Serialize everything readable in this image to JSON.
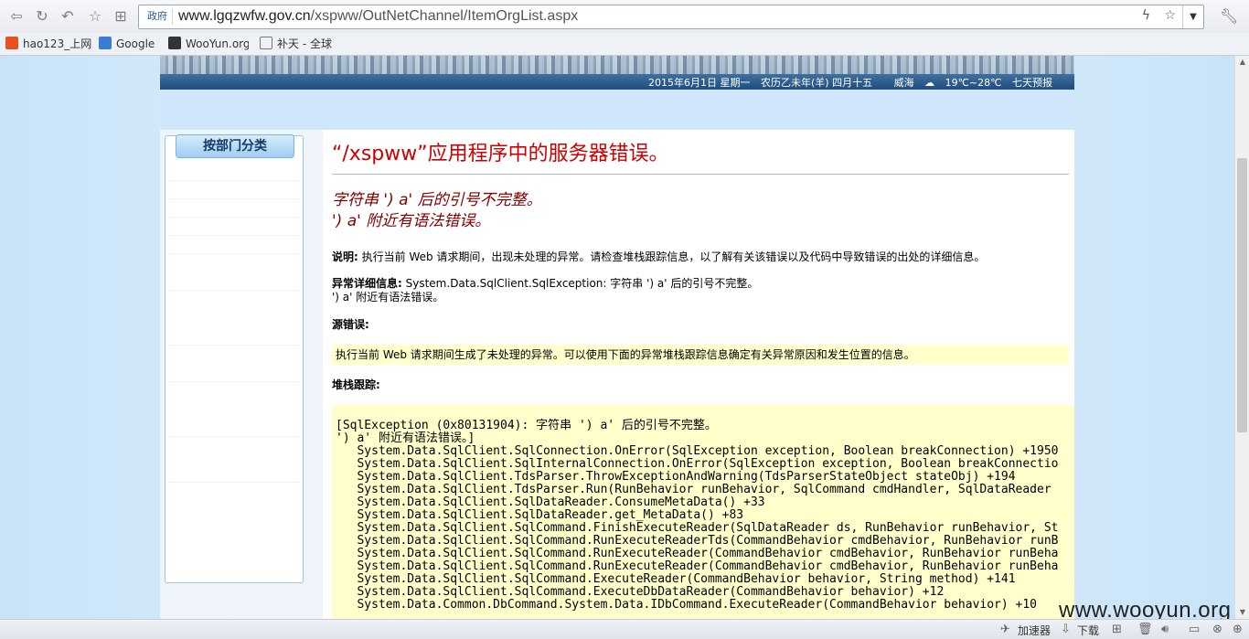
{
  "browser": {
    "address_badge": "政府",
    "url_host": "www.lgqzwfw.gov.cn",
    "url_path": "/xspww/OutNetChannel/ItemOrgList.aspx",
    "bookmarks": [
      "hao123_上网",
      "Google",
      "WooYun.org",
      "补天 - 全球"
    ]
  },
  "banner": {
    "date": "2015年6月1日 星期一",
    "lunar": "农历乙未年(羊) 四月十五",
    "city": "威海",
    "temp": "19℃~28℃",
    "forecast": "七天预报"
  },
  "sidebar": {
    "heading": "按部门分类"
  },
  "error": {
    "title": "“/xspww”应用程序中的服务器错误。",
    "message_line1": "字符串 ') a' 后的引号不完整。",
    "message_line2": "') a' 附近有语法错误。",
    "desc_label": "说明:",
    "desc_text": " 执行当前 Web 请求期间，出现未处理的异常。请检查堆栈跟踪信息，以了解有关该错误以及代码中导致错误的出处的详细信息。",
    "exc_label": "异常详细信息:",
    "exc_text": " System.Data.SqlClient.SqlException: 字符串 ') a' 后的引号不完整。",
    "exc_text2": "') a' 附近有语法错误。",
    "source_label": "源错误:",
    "source_text": "执行当前 Web 请求期间生成了未处理的异常。可以使用下面的异常堆栈跟踪信息确定有关异常原因和发生位置的信息。",
    "stack_label": "堆栈跟踪:",
    "stack_trace": "[SqlException (0x80131904): 字符串 ') a' 后的引号不完整。\n') a' 附近有语法错误。]\n   System.Data.SqlClient.SqlConnection.OnError(SqlException exception, Boolean breakConnection) +1950\n   System.Data.SqlClient.SqlInternalConnection.OnError(SqlException exception, Boolean breakConnectio\n   System.Data.SqlClient.TdsParser.ThrowExceptionAndWarning(TdsParserStateObject stateObj) +194\n   System.Data.SqlClient.TdsParser.Run(RunBehavior runBehavior, SqlCommand cmdHandler, SqlDataReader\n   System.Data.SqlClient.SqlDataReader.ConsumeMetaData() +33\n   System.Data.SqlClient.SqlDataReader.get_MetaData() +83\n   System.Data.SqlClient.SqlCommand.FinishExecuteReader(SqlDataReader ds, RunBehavior runBehavior, St\n   System.Data.SqlClient.SqlCommand.RunExecuteReaderTds(CommandBehavior cmdBehavior, RunBehavior runB\n   System.Data.SqlClient.SqlCommand.RunExecuteReader(CommandBehavior cmdBehavior, RunBehavior runBeha\n   System.Data.SqlClient.SqlCommand.RunExecuteReader(CommandBehavior cmdBehavior, RunBehavior runBeha\n   System.Data.SqlClient.SqlCommand.ExecuteReader(CommandBehavior behavior, String method) +141\n   System.Data.SqlClient.SqlCommand.ExecuteDbDataReader(CommandBehavior behavior) +12\n   System.Data.Common.DbCommand.System.Data.IDbCommand.ExecuteReader(CommandBehavior behavior) +10"
  },
  "statusbar": {
    "accelerator": "加速器",
    "download": "下载"
  },
  "watermark": "www.wooyun.org",
  "icons": {
    "back": "back-icon",
    "forward": "forward-icon",
    "refresh": "refresh-icon",
    "favorite": "star-icon",
    "apps": "apps-grid-icon",
    "wrench": "wrench-icon"
  }
}
